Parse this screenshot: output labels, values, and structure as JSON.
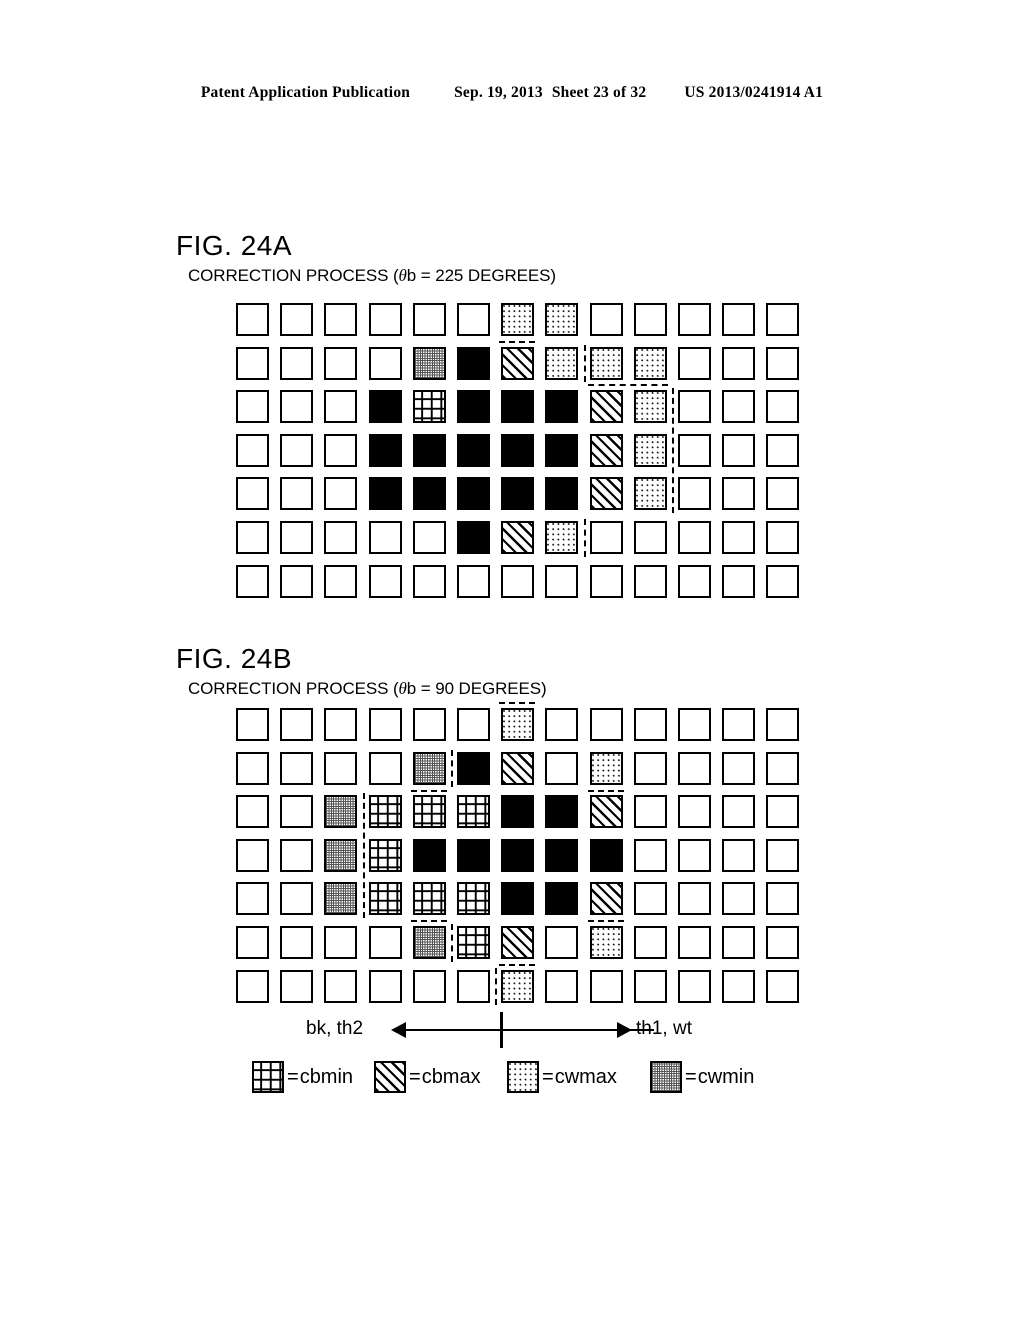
{
  "header": {
    "publication": "Patent Application Publication",
    "date": "Sep. 19, 2013",
    "sheet": "Sheet 23 of 32",
    "number": "US 2013/0241914 A1"
  },
  "figures": [
    {
      "id": "fig-24a",
      "title": "FIG. 24A",
      "caption_before": "CORRECTION PROCESS (",
      "caption_theta": "θ",
      "caption_after": "b = 225 DEGREES)",
      "caption_full": "CORRECTION PROCESS (θb = 225 DEGREES)",
      "grid": {
        "rows": 7,
        "cols": 13,
        "cells": [
          [
            "wt",
            "wt",
            "wt",
            "wt",
            "wt",
            "wt",
            "cwmax",
            "cwmax",
            "wt",
            "wt",
            "wt",
            "wt",
            "wt"
          ],
          [
            "wt",
            "wt",
            "wt",
            "wt",
            "cwmin",
            "bk",
            "cbmax",
            "cwmax",
            "cwmax",
            "cwmax",
            "wt",
            "wt",
            "wt"
          ],
          [
            "wt",
            "wt",
            "wt",
            "bk",
            "cbmin",
            "bk",
            "bk",
            "bk",
            "cbmax",
            "cwmax",
            "wt",
            "wt",
            "wt"
          ],
          [
            "wt",
            "wt",
            "wt",
            "bk",
            "bk",
            "bk",
            "bk",
            "bk",
            "cbmax",
            "cwmax",
            "wt",
            "wt",
            "wt"
          ],
          [
            "wt",
            "wt",
            "wt",
            "bk",
            "bk",
            "bk",
            "bk",
            "bk",
            "cbmax",
            "cwmax",
            "wt",
            "wt",
            "wt"
          ],
          [
            "wt",
            "wt",
            "wt",
            "wt",
            "wt",
            "bk",
            "cbmax",
            "cwmax",
            "wt",
            "wt",
            "wt",
            "wt",
            "wt"
          ],
          [
            "wt",
            "wt",
            "wt",
            "wt",
            "wt",
            "wt",
            "wt",
            "wt",
            "wt",
            "wt",
            "wt",
            "wt",
            "wt"
          ]
        ]
      }
    },
    {
      "id": "fig-24b",
      "title": "FIG. 24B",
      "caption_before": "CORRECTION PROCESS (",
      "caption_theta": "θ",
      "caption_after": "b = 90 DEGREES)",
      "caption_full": "CORRECTION PROCESS (θb = 90 DEGREES)",
      "grid": {
        "rows": 7,
        "cols": 13,
        "cells": [
          [
            "wt",
            "wt",
            "wt",
            "wt",
            "wt",
            "wt",
            "cwmax",
            "wt",
            "wt",
            "wt",
            "wt",
            "wt",
            "wt"
          ],
          [
            "wt",
            "wt",
            "wt",
            "wt",
            "cwmin",
            "bk",
            "cbmax",
            "wt",
            "cwmax",
            "wt",
            "wt",
            "wt",
            "wt"
          ],
          [
            "wt",
            "wt",
            "cwmin",
            "cbmin",
            "cbmin",
            "cbmin",
            "bk",
            "bk",
            "cbmax",
            "wt",
            "wt",
            "wt",
            "wt"
          ],
          [
            "wt",
            "wt",
            "cwmin",
            "cbmin",
            "bk",
            "bk",
            "bk",
            "bk",
            "bk",
            "wt",
            "wt",
            "wt",
            "wt"
          ],
          [
            "wt",
            "wt",
            "cwmin",
            "cbmin",
            "cbmin",
            "cbmin",
            "bk",
            "bk",
            "cbmax",
            "wt",
            "wt",
            "wt",
            "wt"
          ],
          [
            "wt",
            "wt",
            "wt",
            "wt",
            "cwmin",
            "cbmin",
            "cbmax",
            "wt",
            "cwmax",
            "wt",
            "wt",
            "wt",
            "wt"
          ],
          [
            "wt",
            "wt",
            "wt",
            "wt",
            "wt",
            "wt",
            "cwmax",
            "wt",
            "wt",
            "wt",
            "wt",
            "wt",
            "wt"
          ]
        ]
      }
    }
  ],
  "axis": {
    "left_label": "bk, th2",
    "right_label": "th1, wt"
  },
  "legend": {
    "equals": "=",
    "items": [
      {
        "pattern": "cbmin",
        "label": "cbmin"
      },
      {
        "pattern": "cbmax",
        "label": "cbmax"
      },
      {
        "pattern": "cwmax",
        "label": "cwmax"
      },
      {
        "pattern": "cwmin",
        "label": "cwmin"
      }
    ]
  },
  "colors": {
    "ink": "#000000",
    "paper": "#ffffff",
    "gray": "#555555"
  }
}
